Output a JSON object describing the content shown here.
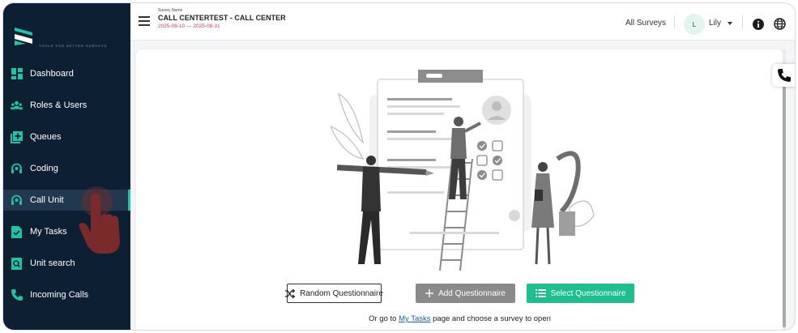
{
  "app": {
    "logo_text": "TOOLS FOR BETTER SURVEYS"
  },
  "sidebar": {
    "items": [
      {
        "label": "Dashboard",
        "icon": "dashboard-icon"
      },
      {
        "label": "Roles & Users",
        "icon": "users-icon"
      },
      {
        "label": "Queues",
        "icon": "queue-icon"
      },
      {
        "label": "Coding",
        "icon": "headset-icon"
      },
      {
        "label": "Call Unit",
        "icon": "headset-icon",
        "active": true
      },
      {
        "label": "My Tasks",
        "icon": "tasks-icon"
      },
      {
        "label": "Unit search",
        "icon": "search-doc-icon"
      },
      {
        "label": "Incoming Calls",
        "icon": "phone-icon"
      }
    ]
  },
  "header": {
    "survey_label": "Survey Name",
    "survey_name": "CALL CENTERTEST - CALL CENTER",
    "survey_dates": "2025-08-10 — 2025-08-31",
    "all_surveys": "All Surveys",
    "avatar_initial": "L",
    "user_name": "Lily"
  },
  "main": {
    "random_label": "Random Questionnaire",
    "add_label": "Add Questionnaire",
    "select_label": "Select Questionnaire",
    "footer_prefix": "Or go to ",
    "footer_link": "My Tasks",
    "footer_suffix": " page and choose a survey to open"
  },
  "colors": {
    "sidebar_bg": "#0d1f33",
    "accent": "#1dbf8f",
    "active_item_bg": "#21384f",
    "date_color": "#c0396b"
  }
}
